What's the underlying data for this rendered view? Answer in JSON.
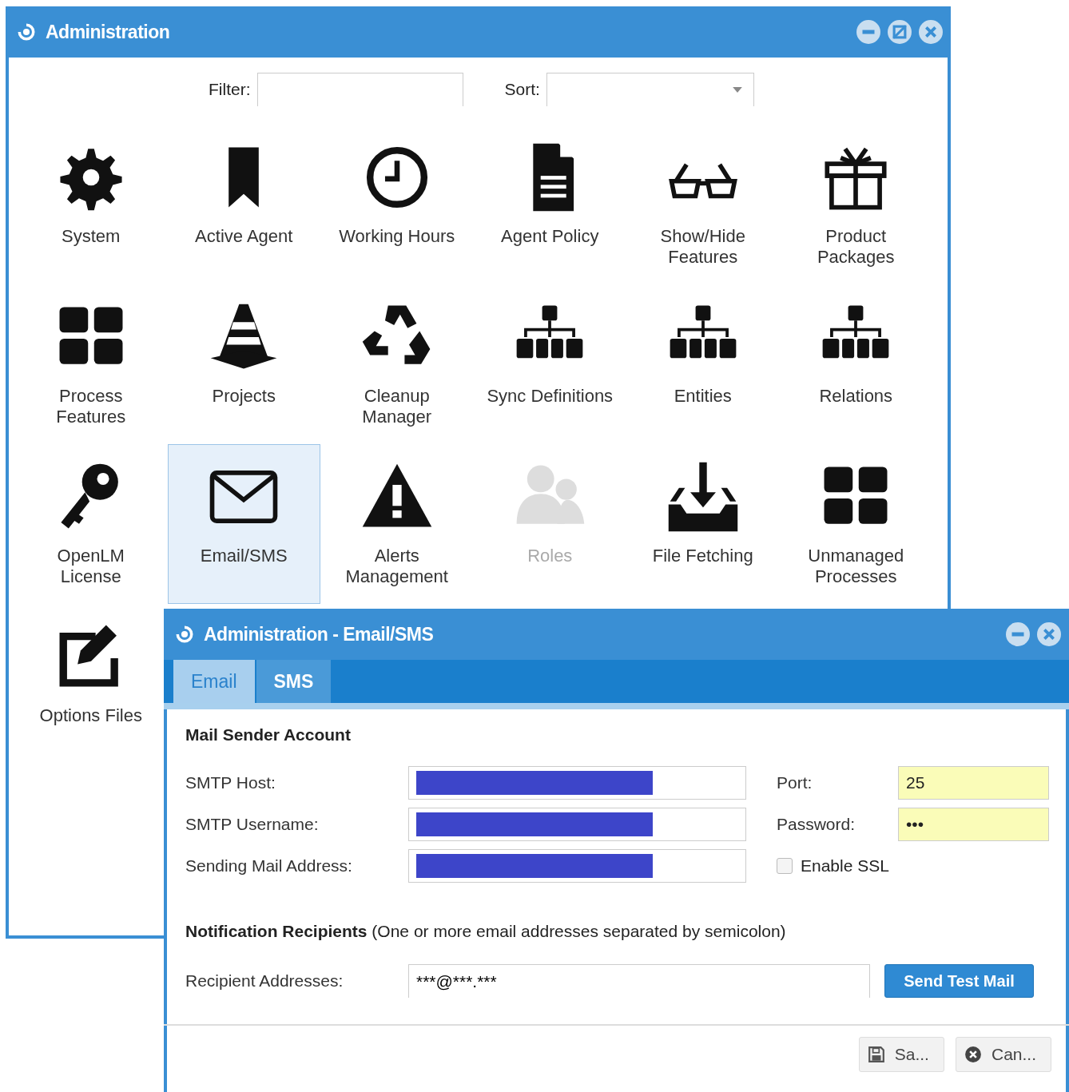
{
  "main_window": {
    "title": "Administration"
  },
  "filter": {
    "label": "Filter:"
  },
  "sort": {
    "label": "Sort:"
  },
  "items": [
    {
      "label": "System",
      "selected": false,
      "disabled": false
    },
    {
      "label": "Active Agent",
      "selected": false,
      "disabled": false
    },
    {
      "label": "Working Hours",
      "selected": false,
      "disabled": false
    },
    {
      "label": "Agent Policy",
      "selected": false,
      "disabled": false
    },
    {
      "label": "Show/Hide Features",
      "selected": false,
      "disabled": false
    },
    {
      "label": "Product\nPackages",
      "selected": false,
      "disabled": false
    },
    {
      "label": "Process\nFeatures",
      "selected": false,
      "disabled": false
    },
    {
      "label": "Projects",
      "selected": false,
      "disabled": false
    },
    {
      "label": "Cleanup\nManager",
      "selected": false,
      "disabled": false
    },
    {
      "label": "Sync Definitions",
      "selected": false,
      "disabled": false
    },
    {
      "label": "Entities",
      "selected": false,
      "disabled": false
    },
    {
      "label": "Relations",
      "selected": false,
      "disabled": false
    },
    {
      "label": "OpenLM\nLicense",
      "selected": false,
      "disabled": false
    },
    {
      "label": "Email/SMS",
      "selected": true,
      "disabled": false
    },
    {
      "label": "Alerts Management",
      "selected": false,
      "disabled": false
    },
    {
      "label": "Roles",
      "selected": false,
      "disabled": true
    },
    {
      "label": "File Fetching",
      "selected": false,
      "disabled": false
    },
    {
      "label": "Unmanaged Processes",
      "selected": false,
      "disabled": false
    },
    {
      "label": "Options Files",
      "selected": false,
      "disabled": false
    }
  ],
  "dialog": {
    "title": "Administration - Email/SMS",
    "tabs": [
      {
        "label": "Email",
        "selected": true
      },
      {
        "label": "SMS",
        "selected": false
      }
    ],
    "section_title": "Mail Sender Account",
    "fields": [
      {
        "label": "SMTP Host:",
        "redacted": true
      },
      {
        "label": "SMTP Username:",
        "redacted": true
      },
      {
        "label": "Sending Mail Address:",
        "redacted": true
      }
    ],
    "side_fields": [
      {
        "kind": "field",
        "label": "Port:",
        "value": "25",
        "highlighted": true
      },
      {
        "kind": "field",
        "label": "Password:",
        "value": "•••",
        "highlighted": true
      },
      {
        "kind": "checkbox",
        "label": "Enable SSL",
        "checked": false
      }
    ],
    "recipients_heading": "**Notification Recipients** (One or more email addresses separated by semicolon)",
    "recipients": {
      "label": "Recipient Addresses:",
      "value": "***@***.***"
    },
    "send_button": "Send Test Mail",
    "footer_buttons": [
      {
        "kind": "save",
        "label": "Sa..."
      },
      {
        "kind": "cancel",
        "label": "Can..."
      }
    ]
  }
}
